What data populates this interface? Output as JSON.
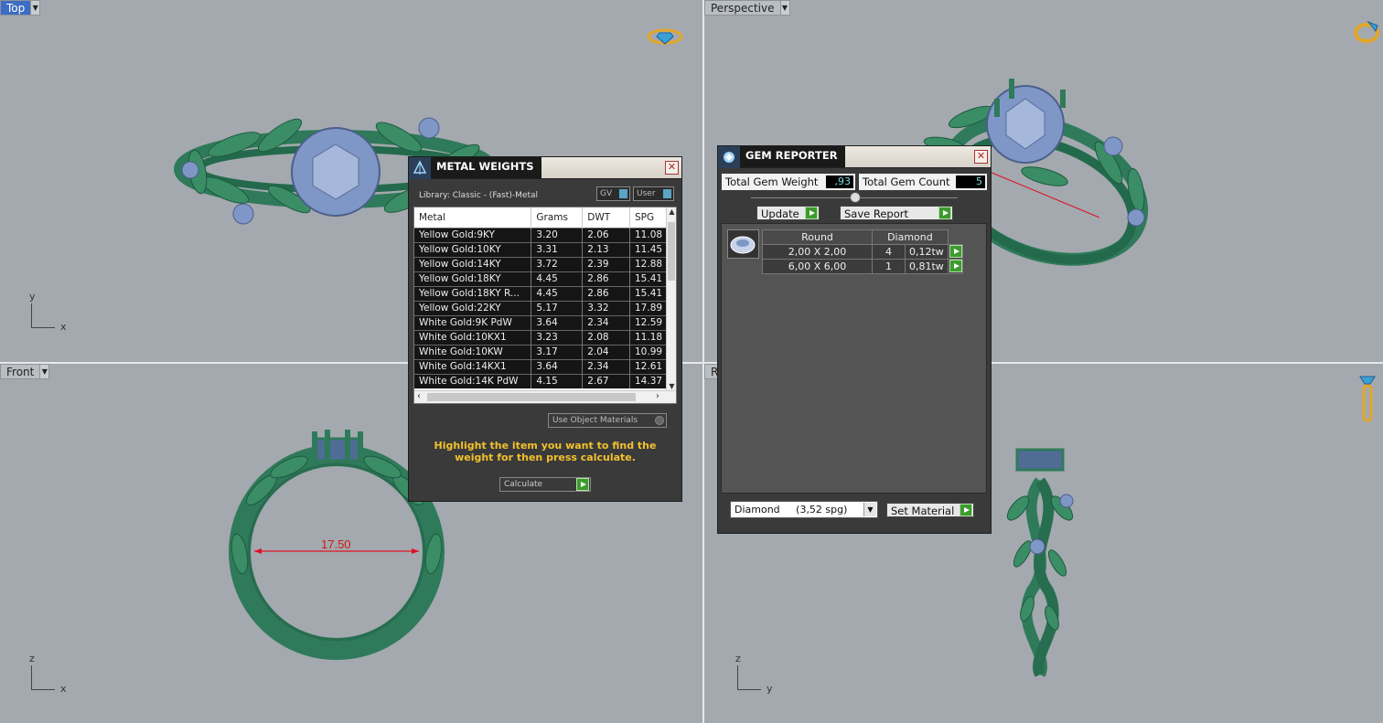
{
  "viewports": {
    "top": {
      "title": "Top",
      "axis_v": "y",
      "axis_h": "x"
    },
    "perspective": {
      "title": "Perspective"
    },
    "front": {
      "title": "Front",
      "axis_v": "z",
      "axis_h": "x",
      "dimension": "17.50"
    },
    "right": {
      "title": "R",
      "axis_v": "z",
      "axis_h": "y"
    }
  },
  "metal_weights": {
    "title": "METAL WEIGHTS",
    "library": "Library: Classic - (Fast)-Metal",
    "toggle_gv": "GV",
    "toggle_user": "User",
    "columns": [
      "Metal",
      "Grams",
      "DWT",
      "SPG"
    ],
    "rows": [
      [
        "Yellow Gold:9KY",
        "3.20",
        "2.06",
        "11.08"
      ],
      [
        "Yellow Gold:10KY",
        "3.31",
        "2.13",
        "11.45"
      ],
      [
        "Yellow Gold:14KY",
        "3.72",
        "2.39",
        "12.88"
      ],
      [
        "Yellow Gold:18KY",
        "4.45",
        "2.86",
        "15.41"
      ],
      [
        "Yellow Gold:18KY R...",
        "4.45",
        "2.86",
        "15.41"
      ],
      [
        "Yellow Gold:22KY",
        "5.17",
        "3.32",
        "17.89"
      ],
      [
        "White Gold:9K PdW",
        "3.64",
        "2.34",
        "12.59"
      ],
      [
        "White Gold:10KX1",
        "3.23",
        "2.08",
        "11.18"
      ],
      [
        "White Gold:10KW",
        "3.17",
        "2.04",
        "10.99"
      ],
      [
        "White Gold:14KX1",
        "3.64",
        "2.34",
        "12.61"
      ],
      [
        "White Gold:14K PdW",
        "4.15",
        "2.67",
        "14.37"
      ]
    ],
    "use_object_materials": "Use Object Materials",
    "hint": "Highlight the item you want to find the weight for then press calculate.",
    "calculate": "Calculate"
  },
  "gem_reporter": {
    "title": "GEM REPORTER",
    "total_weight_label": "Total Gem Weight",
    "total_weight_value": ",93",
    "total_count_label": "Total Gem Count",
    "total_count_value": "5",
    "update": "Update",
    "save_report": "Save Report",
    "columns": [
      "Round",
      "",
      "Diamond"
    ],
    "rows": [
      [
        "2,00 X 2,00",
        "4",
        "0,12tw"
      ],
      [
        "6,00 X 6,00",
        "1",
        "0,81tw"
      ]
    ],
    "material_select": "Diamond     (3,52 spg)",
    "set_material": "Set Material"
  },
  "colors": {
    "ring_green": "#2f7a5a",
    "gem_blue": "#8aa3cf",
    "viewport_bg": "#a3a9ae",
    "hint_yellow": "#f2c12e"
  }
}
